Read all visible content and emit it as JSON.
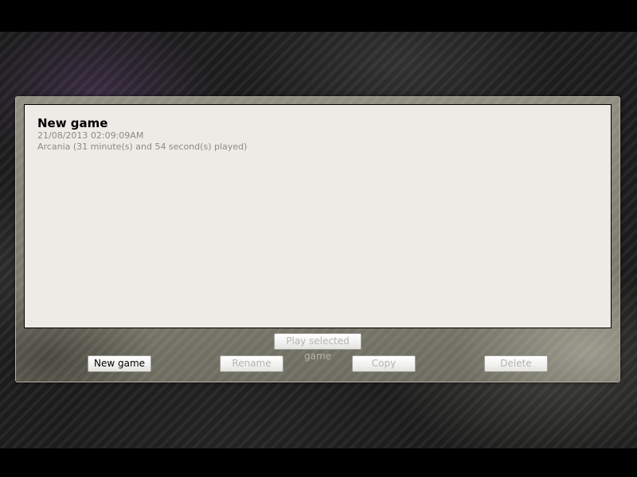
{
  "saves": [
    {
      "title": "New game",
      "timestamp": "21/08/2013 02:09:09AM",
      "details": "Arcania (31 minute(s) and 54 second(s) played)"
    }
  ],
  "buttons": {
    "play": {
      "label": "Play selected game",
      "enabled": false
    },
    "new_game": {
      "label": "New game",
      "enabled": true
    },
    "rename": {
      "label": "Rename",
      "enabled": false
    },
    "copy": {
      "label": "Copy",
      "enabled": false
    },
    "delete": {
      "label": "Delete",
      "enabled": false
    }
  },
  "colors": {
    "list_background": "#eeebe6",
    "disabled_text": "#b4b4b0",
    "meta_text": "#8a8a8a"
  }
}
